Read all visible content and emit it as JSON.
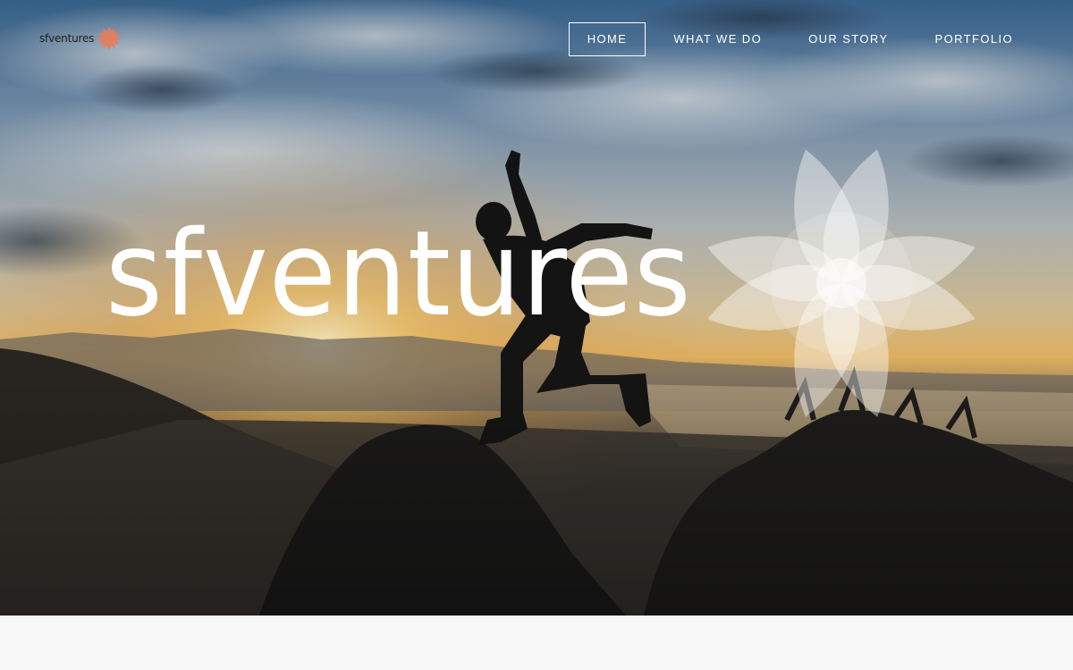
{
  "header": {
    "logo_text": "sfventures",
    "logo_mark_icon": "starburst-flower-icon",
    "nav": [
      {
        "label": "HOME",
        "active": true
      },
      {
        "label": "WHAT WE DO",
        "active": false
      },
      {
        "label": "OUR STORY",
        "active": false
      },
      {
        "label": "PORTFOLIO",
        "active": false
      }
    ]
  },
  "hero": {
    "title": "sfventures",
    "emblem_icon": "six-petal-flower-icon",
    "background": "silhouette-jumping-person-sunset-photo"
  },
  "colors": {
    "nav_text": "#ffffff",
    "title_text": "#ffffff",
    "logo_accent": "#f07a55",
    "below_hero": "#f8f8f8"
  }
}
